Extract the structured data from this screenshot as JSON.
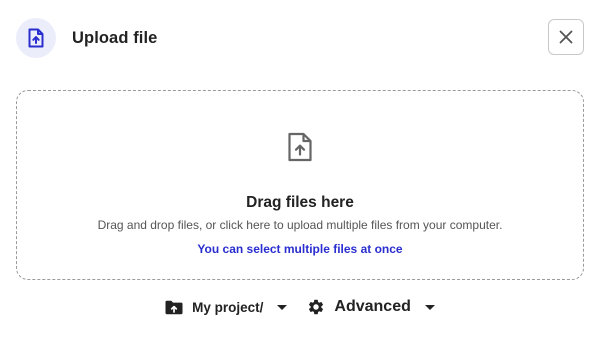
{
  "dialog": {
    "title": "Upload file",
    "header_icon": "file-upload-icon",
    "close_icon": "close-icon"
  },
  "dropzone": {
    "icon": "file-upload-icon",
    "title": "Drag files here",
    "description": "Drag and drop files, or click here to upload multiple files from your computer.",
    "hint": "You can select multiple files at once"
  },
  "footer": {
    "project": {
      "icon": "folder-upload-icon",
      "label": "My project/",
      "chevron_icon": "chevron-down-icon"
    },
    "advanced": {
      "icon": "gear-icon",
      "label": "Advanced",
      "chevron_icon": "chevron-down-icon"
    }
  },
  "colors": {
    "accent": "#2a2ecf",
    "header_icon_bg": "#ecedfb",
    "dropzone_border": "#9a9a9a",
    "text_primary": "#222222",
    "text_secondary": "#555555"
  }
}
